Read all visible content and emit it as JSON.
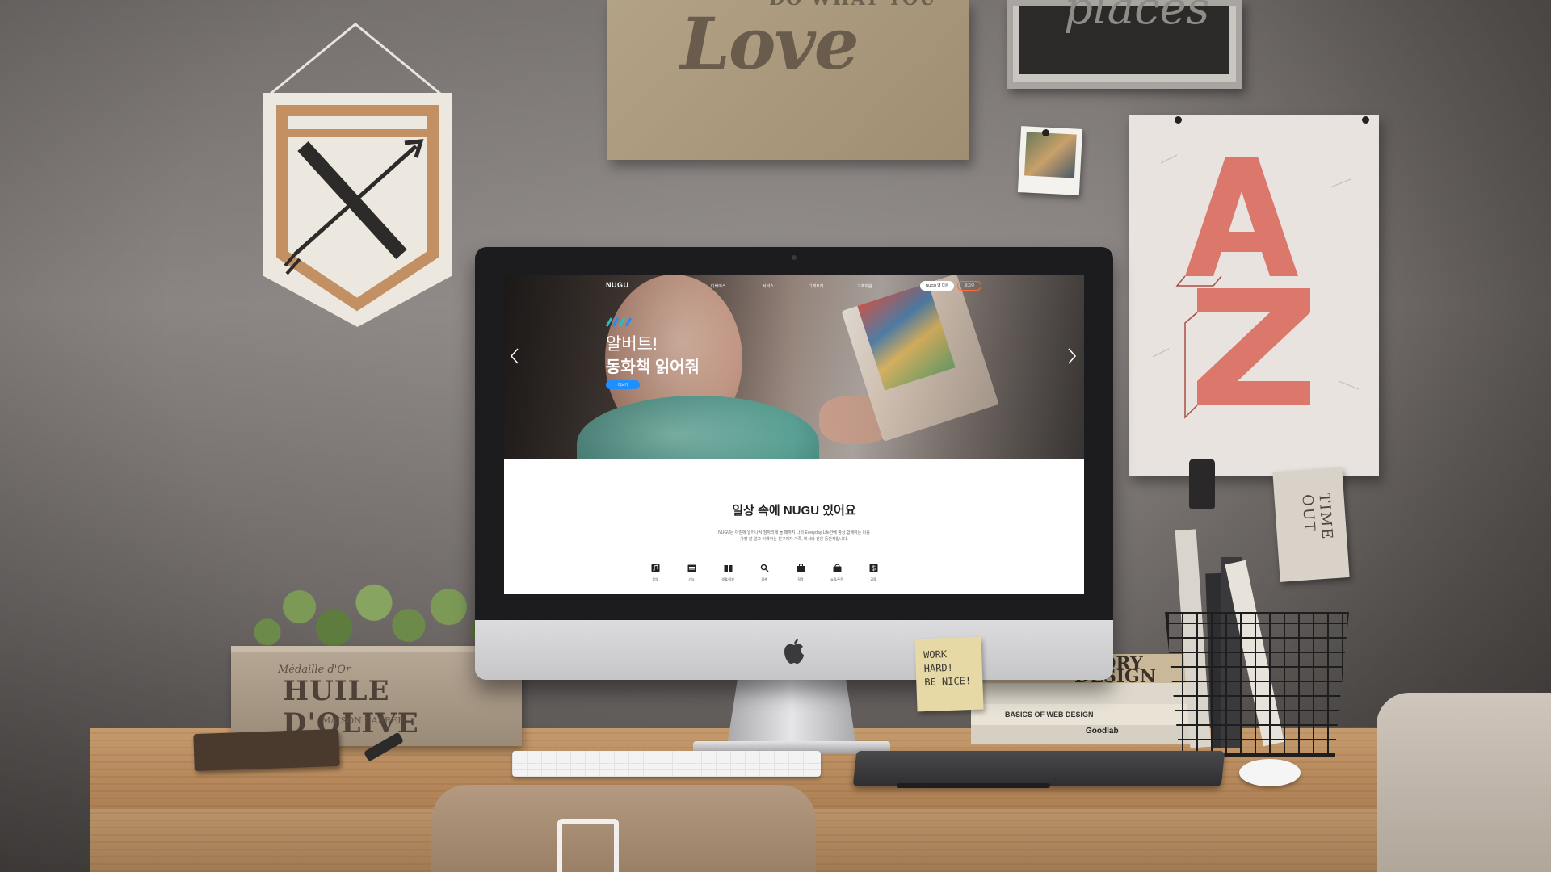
{
  "website": {
    "logo": "NUGU",
    "nav": [
      "디바이스",
      "서비스",
      "디렉토리",
      "고객지원"
    ],
    "app_button": "NUGU 앱 다운",
    "login_button": "로그인",
    "hero": {
      "title": "알버트!",
      "subtitle": "동화책 읽어줘",
      "button": "더보기",
      "slides": 3,
      "active_slide": 1
    },
    "section": {
      "title": "일상 속에 NUGU 있어요",
      "description_line1": "NUGU는 아침에 일어나서 잠자리에 들 때까지 나의 Everyday Life안에 항상 함께하는 나를",
      "description_line2": "가장 잘 알고 이해하는 친구이자 가족, 비서와 같은 동반자입니다."
    },
    "features": [
      {
        "label": "음악",
        "icon": "music-icon"
      },
      {
        "label": "기능",
        "icon": "calendar-icon"
      },
      {
        "label": "생활/정보",
        "icon": "book-icon"
      },
      {
        "label": "검색",
        "icon": "search-icon"
      },
      {
        "label": "직장",
        "icon": "briefcase-icon"
      },
      {
        "label": "쇼핑/주문",
        "icon": "shopping-icon"
      },
      {
        "label": "금융",
        "icon": "dollar-icon"
      }
    ],
    "colors": {
      "accent_blue": "#1e8fff",
      "login_orange": "#ff6a3d",
      "mark_teal": "#22c1c3"
    }
  },
  "scene": {
    "poster_love_top": "DO WHAT YOU",
    "poster_love": "Love",
    "chalkboard": "places",
    "crate_sub": "Médaille d'Or",
    "crate_title": "HUILE D'OLIVE",
    "crate_small": "MAISON CARRÉE",
    "sticky_note": "WORK\nHARD!\nBE NICE!",
    "book_story": "STORY\nDESIGN",
    "book_basics": "BASICS OF WEB DESIGN",
    "book_goodlab": "Goodlab",
    "timeout_card": "TIME OUT"
  }
}
